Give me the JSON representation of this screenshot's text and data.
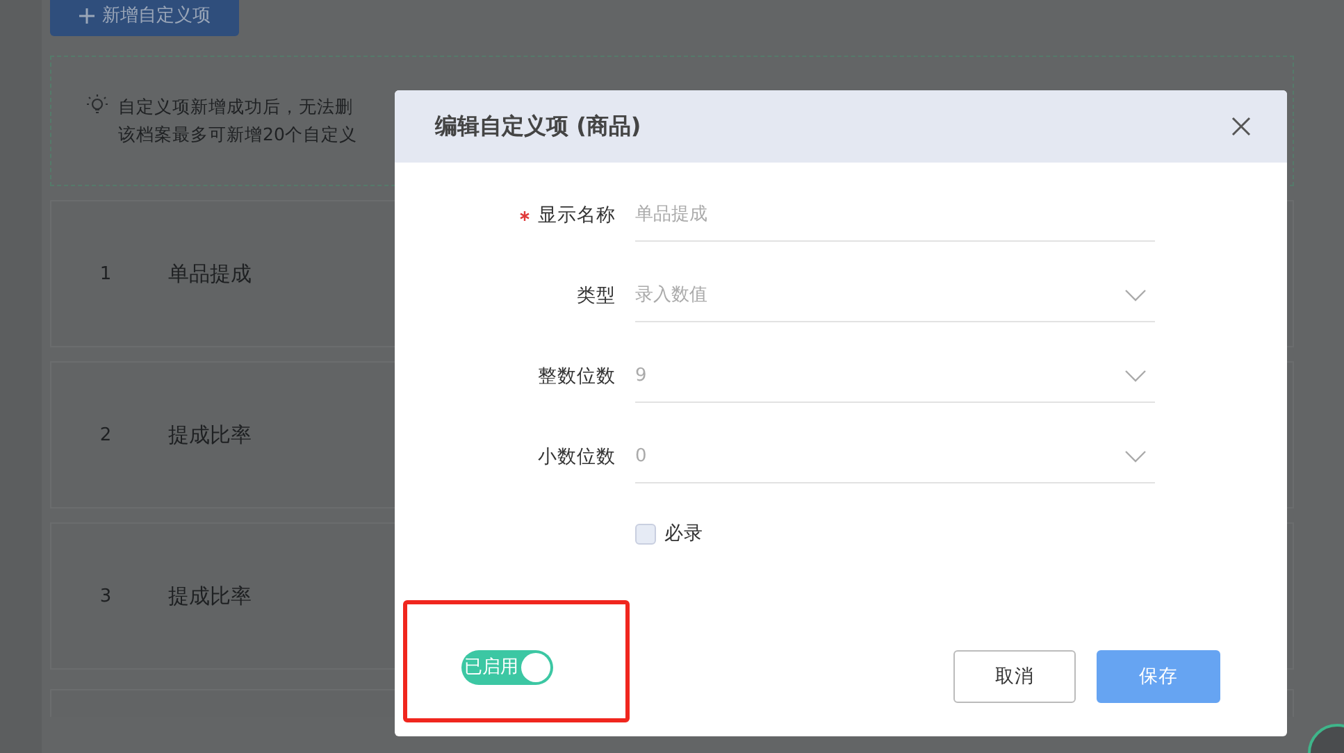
{
  "page": {
    "add_button": "新增自定义项",
    "tip": [
      "自定义项新增成功后，无法删",
      "该档案最多可新增20个自定义"
    ],
    "rows": [
      {
        "index": "1",
        "name": "单品提成"
      },
      {
        "index": "2",
        "name": "提成比率"
      },
      {
        "index": "3",
        "name": "提成比率"
      }
    ]
  },
  "dialog": {
    "title": "编辑自定义项 (商品)",
    "fields": [
      {
        "kind": "text",
        "label": "显示名称",
        "required": true,
        "value": "单品提成"
      },
      {
        "kind": "select",
        "label": "类型",
        "required": false,
        "value": "录入数值"
      },
      {
        "kind": "select",
        "label": "整数位数",
        "required": false,
        "value": "9"
      },
      {
        "kind": "select",
        "label": "小数位数",
        "required": false,
        "value": "0"
      }
    ],
    "checkbox": {
      "label": "必录",
      "checked": false
    },
    "toggle": {
      "label": "已启用",
      "on": true
    },
    "buttons": [
      {
        "kind": "default",
        "label": "取消"
      },
      {
        "kind": "primary",
        "label": "保存"
      }
    ]
  }
}
